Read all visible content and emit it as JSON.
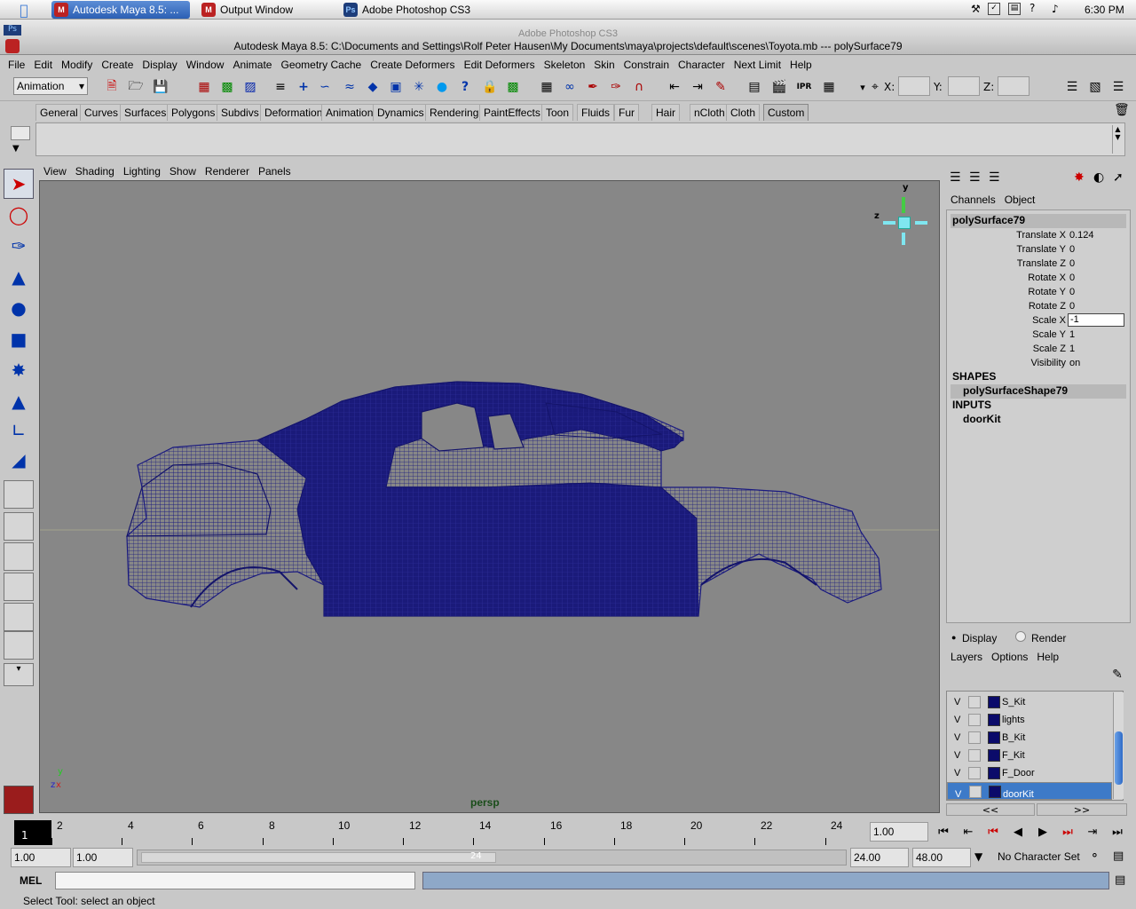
{
  "mac_menubar": {
    "tabs": [
      {
        "label": "Autodesk Maya 8.5: ...",
        "icon": "maya-icon",
        "active": true
      },
      {
        "label": "Output Window",
        "icon": "maya-icon",
        "active": false
      },
      {
        "label": "Adobe Photoshop CS3",
        "icon": "photoshop-icon",
        "active": false
      }
    ],
    "clock": "6:30 PM"
  },
  "window": {
    "ghost_title": "Adobe Photoshop CS3",
    "title": "Autodesk Maya 8.5: C:\\Documents and Settings\\Rolf Peter Hausen\\My Documents\\maya\\projects\\default\\scenes\\Toyota.mb  ---  polySurface79"
  },
  "main_menu": [
    "File",
    "Edit",
    "Modify",
    "Create",
    "Display",
    "Window",
    "Animate",
    "Geometry Cache",
    "Create Deformers",
    "Edit Deformers",
    "Skeleton",
    "Skin",
    "Constrain",
    "Character",
    "Next Limit",
    "Help"
  ],
  "status_line": {
    "menu_set": "Animation",
    "x_label": "X:",
    "y_label": "Y:",
    "z_label": "Z:"
  },
  "shelf_tabs": [
    "General",
    "Curves",
    "Surfaces",
    "Polygons",
    "Subdivs",
    "Deformation",
    "Animation",
    "Dynamics",
    "Rendering",
    "PaintEffects",
    "Toon",
    "Fluids",
    "Fur",
    "Hair",
    "nCloth",
    "Cloth",
    "Custom"
  ],
  "viewport": {
    "menu": [
      "View",
      "Shading",
      "Lighting",
      "Show",
      "Renderer",
      "Panels"
    ],
    "camera": "persp",
    "axis_labels": {
      "y": "y",
      "z": "z",
      "x": "x"
    },
    "wire_color": "#1a1a80",
    "background": "#878787"
  },
  "channel_box": {
    "menu": [
      "Channels",
      "Object"
    ],
    "object": "polySurface79",
    "channels": [
      {
        "label": "Translate X",
        "value": "0.124"
      },
      {
        "label": "Translate Y",
        "value": "0"
      },
      {
        "label": "Translate Z",
        "value": "0"
      },
      {
        "label": "Rotate X",
        "value": "0"
      },
      {
        "label": "Rotate Y",
        "value": "0"
      },
      {
        "label": "Rotate Z",
        "value": "0"
      },
      {
        "label": "Scale X",
        "value": "-1"
      },
      {
        "label": "Scale Y",
        "value": "1"
      },
      {
        "label": "Scale Z",
        "value": "1"
      },
      {
        "label": "Visibility",
        "value": "on"
      }
    ],
    "shapes_header": "SHAPES",
    "shape": "polySurfaceShape79",
    "inputs_header": "INPUTS",
    "input": "doorKit"
  },
  "layer_editor": {
    "display_label": "Display",
    "render_label": "Render",
    "menu": [
      "Layers",
      "Options",
      "Help"
    ],
    "layers": [
      {
        "visible": "V",
        "name": "S_Kit",
        "selected": false
      },
      {
        "visible": "V",
        "name": "lights",
        "selected": false
      },
      {
        "visible": "V",
        "name": "B_Kit",
        "selected": false
      },
      {
        "visible": "V",
        "name": "F_Kit",
        "selected": false
      },
      {
        "visible": "V",
        "name": "F_Door",
        "selected": false
      },
      {
        "visible": "V",
        "name": "doorKit",
        "selected": true
      }
    ],
    "scroll_left": "<<",
    "scroll_right": ">>"
  },
  "time_slider": {
    "current_frame": "1",
    "ticks": [
      "2",
      "4",
      "6",
      "8",
      "10",
      "12",
      "14",
      "16",
      "18",
      "20",
      "22",
      "24"
    ],
    "current_time": "1.00"
  },
  "range_slider": {
    "start_time": "1.00",
    "playback_start": "1.00",
    "range_end_marker": "24",
    "playback_end": "24.00",
    "end_time": "48.00",
    "character_set": "No Character Set"
  },
  "command_line": {
    "label": "MEL"
  },
  "help_line": "Select Tool: select an object"
}
